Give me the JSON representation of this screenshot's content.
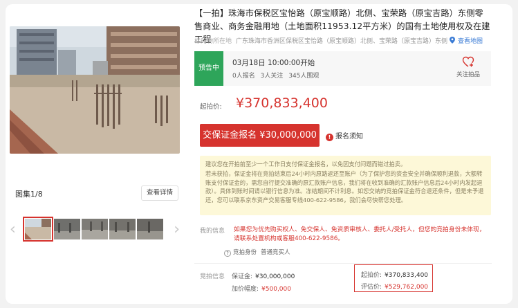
{
  "title": "【一拍】珠海市保税区宝怡路（原宝顺路）北侧、宝荣路（原宝吉路）东侧零售商业、商务金融用地（土地面积11953.12平方米）的国有土地使用权及在建工程",
  "location": {
    "label": "标的物所在地",
    "address": "广东珠海市香洲区保税区宝怡路（原宝顺路）北侧、宝荣路（原宝吉路）东侧",
    "map_link": "查看地图"
  },
  "status": {
    "badge": "预告中",
    "start_time": "03月18日 10:00:00开始",
    "signup": "0人报名",
    "watching": "3人关注",
    "views": "345人围观",
    "follow_label": "关注拍品"
  },
  "price": {
    "label": "起拍价:",
    "value": "¥370,833,400"
  },
  "deposit_button": "交保证金报名 ¥30,000,000",
  "notice_link": "报名须知",
  "tips": [
    "建议您在开拍前至少一个工作日支付保证金报名，以免因支付问题而错过拍卖。",
    "若未获拍，保证金将在竞拍结束后24小时内原路返还至账户（为了保护您的资金安全并确保顺利退款，大额转账支付保证金的，需您自行提交准确的原汇款账户信息，我们将在收到准确的汇款账户信息后24小时内发起退款）。具体到账时间请以银行信息为准。冻结期间不计利息。如您交纳的竞拍保证金符合退还条件，但是未予退还，您可以联系京东资产交易客服专线400-622-9586，我们会尽快帮您处理。"
  ],
  "bid_info": {
    "label": "我的信息",
    "text": "如果您为优先购买权人、免交保人、免资质审核人、委托人/受托人，但您的竞拍身份未体现，请联系处置机构或客服400-622-9586。",
    "identity_label": "竞拍身份",
    "identity_value": "普通竞买人"
  },
  "auction": {
    "label": "竞拍信息",
    "deposit_key": "保证金:",
    "deposit_value": "¥30,000,000",
    "increment_key": "加价幅度:",
    "increment_value": "¥500,000",
    "start_key": "起拍价:",
    "start_value": "¥370,833,400",
    "assess_key": "评估价:",
    "assess_value": "¥529,762,000"
  },
  "gallery": {
    "count": "图集1/8",
    "view_detail": "查看详情"
  },
  "colors": {
    "accent": "#d6332e",
    "status_green": "#2ea55a",
    "tip_bg": "#fdf8d8",
    "link_blue": "#3a7bd5"
  }
}
